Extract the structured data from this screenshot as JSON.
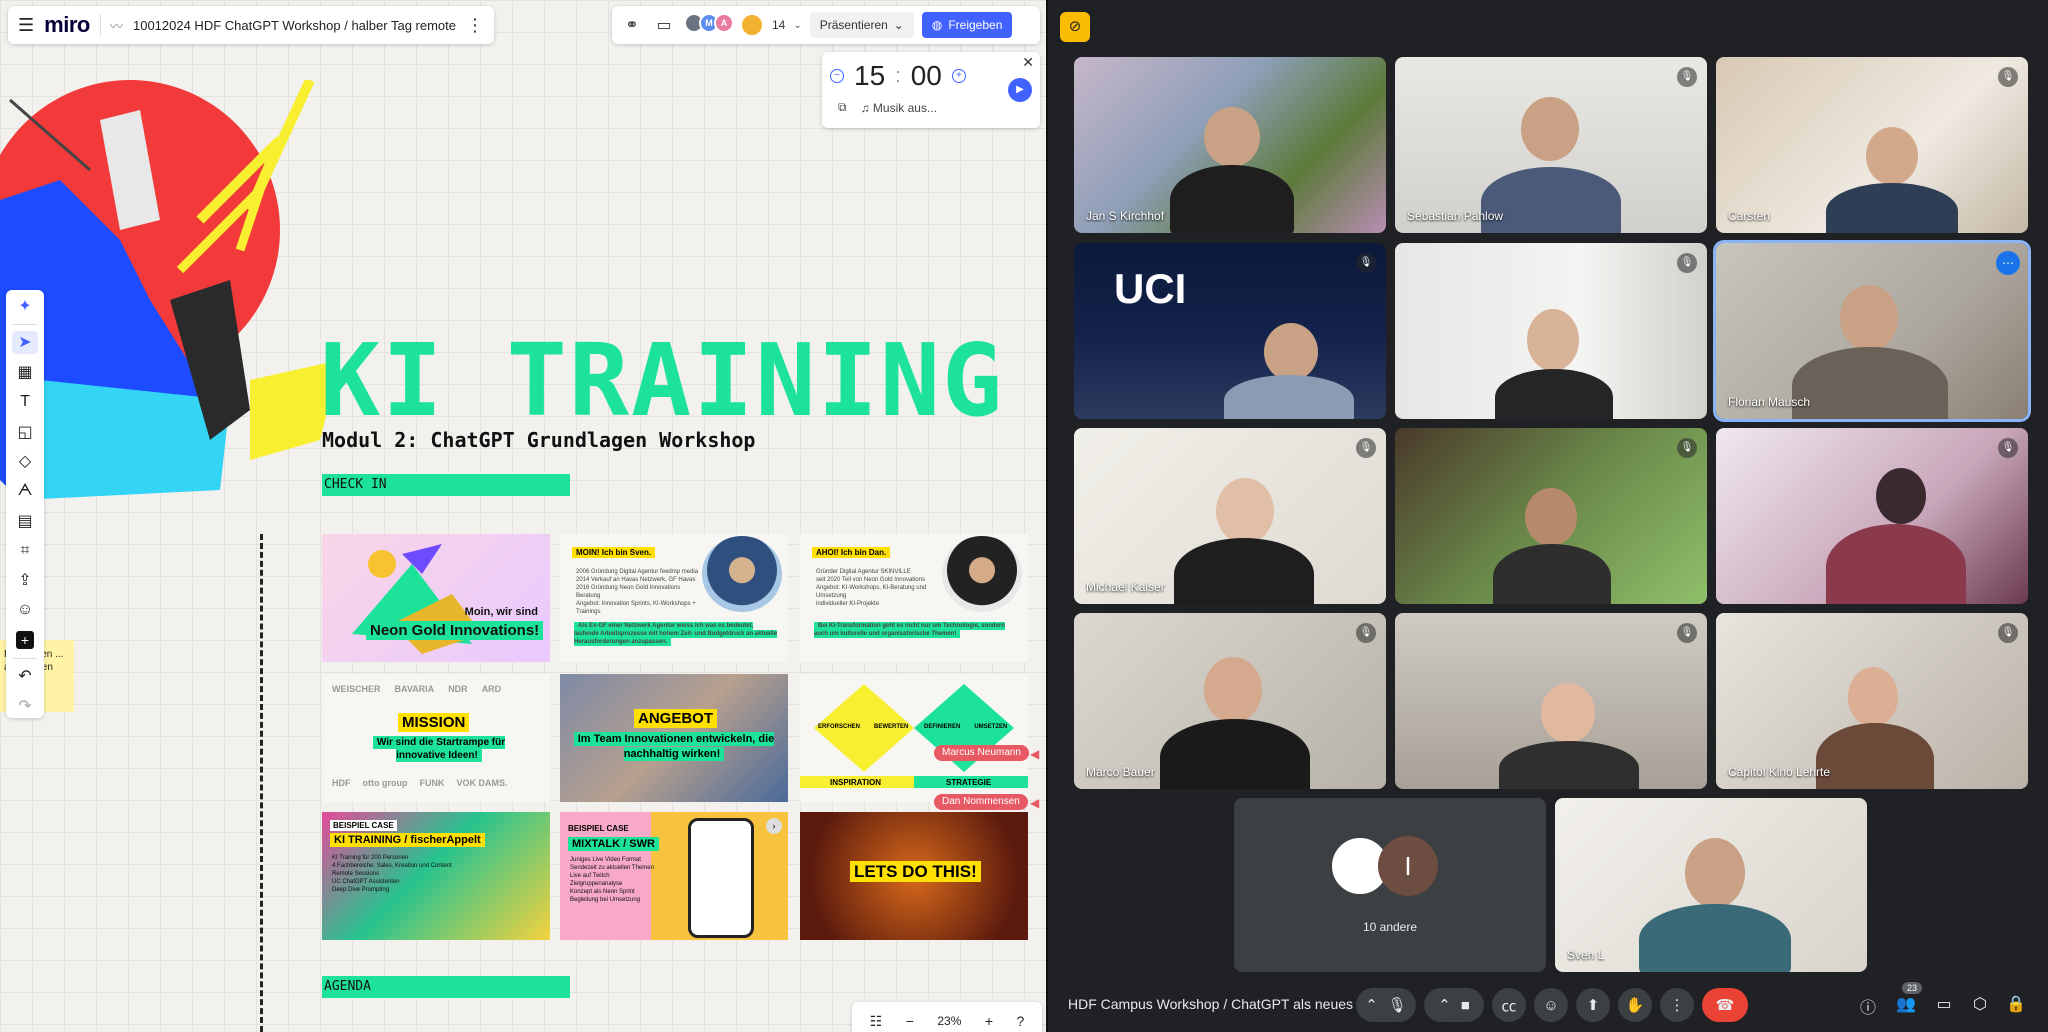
{
  "miro": {
    "logo": "miro",
    "board_name": "10012024 HDF ChatGPT Workshop / halber Tag remote",
    "collaborators_count": "14",
    "avatar_initials": [
      "",
      "M",
      "A"
    ],
    "present_label": "Präsentieren",
    "share_label": "Freigeben",
    "timer": {
      "minutes": "15",
      "seconds": "00",
      "music_label": "Musik aus..."
    },
    "zoom": "23%",
    "sticky_text": "F... Cr... en ... auf ... cken"
  },
  "board": {
    "title": "KI TRAINING",
    "subtitle": "Modul 2: ChatGPT Grundlagen Workshop",
    "checkin_label": "CHECK IN",
    "agenda_label": "AGENDA",
    "cards": [
      {
        "caption_line1": "Moin, wir sind",
        "caption_line2": "Neon Gold Innovations!"
      },
      {
        "header": "MOIN! Ich bin Sven.",
        "bullets": [
          "2006 Gründung Digital Agentur feedmp media",
          "2014 Verkauf an Havas Netzwerk, GF Havas",
          "2016 Gründung Neon Gold Innovations Beratung",
          "Angebot: Innovation Sprints, KI-Workshops + Trainings"
        ],
        "highlight": "Als Ex-GF einer Netzwerk Agentur weiss ich was es bedeutet, laufende Arbeitsprozesse mit hohem Zeit- und Budgetdruck an aktuelle Herausforderungen anzupassen."
      },
      {
        "header": "AHOI! Ich bin Dan.",
        "bullets": [
          "Gründer Digital Agentur SKINVILLE",
          "seit 2020 Teil von Neon Gold Innovations",
          "Angebot: KI-Workshops, KI-Beratung und Umsetzung",
          "individueller KI-Projekte"
        ],
        "highlight": "Bei KI-Transformation geht es nicht nur um Technologie, sondern auch um kulturelle und organisatorische Themen!"
      },
      {
        "logos": [
          "WEISCHER",
          "BAVARIA",
          "NDR",
          "ARD"
        ],
        "title": "MISSION",
        "text": "Wir sind die Startrampe für innovative Ideen!",
        "logos2": [
          "HDF",
          "otto group",
          "FUNK",
          "VOK DAMS."
        ]
      },
      {
        "title": "ANGEBOT",
        "text": "Im Team Innovationen entwickeln, die nachhaltig wirken!"
      },
      {
        "labels": [
          "ERFORSCHEN",
          "BEWERTEN",
          "DEFINIEREN",
          "UMSETZEN"
        ],
        "bottom": [
          "INSPIRATION",
          "STRATEGIE"
        ]
      },
      {
        "tag": "BEISPIEL CASE",
        "title": "KI TRAINING / fischerAppelt",
        "lines": [
          "KI Training für 200 Personen",
          "4 Fachbereiche: Sales, Kreation und Content",
          "Remote Sessions",
          "UC ChatGPT Assistenten",
          "Deep Dive Prompting"
        ]
      },
      {
        "tag": "BEISPIEL CASE",
        "title": "MIXTALK / SWR",
        "lines": [
          "Juniges Live Video Format",
          "Sendezeit zu aktuellen Themen",
          "Live auf Twitch",
          "Zielgruppenanalyse",
          "Konzept als Neon Sprint",
          "Begleitung bei Umsetzung"
        ]
      },
      {
        "title": "LETS DO THIS!"
      }
    ],
    "cursors": [
      "Marcus Neumann",
      "Dan Nommensen"
    ]
  },
  "meet": {
    "tiles": [
      {
        "name": "Jan S Kirchhof"
      },
      {
        "name": "Sebastian Pahlow"
      },
      {
        "name": "Carsten"
      },
      {
        "name": "",
        "bg_text": "UCI"
      },
      {
        "name": ""
      },
      {
        "name": "Florian Mausch"
      },
      {
        "name": "Michael Kaiser"
      },
      {
        "name": ""
      },
      {
        "name": ""
      },
      {
        "name": "Marco Bauer"
      },
      {
        "name": ""
      },
      {
        "name": "Capitol Kino Lehrte"
      }
    ],
    "others_label": "10 andere",
    "self_name": "Sven L",
    "meeting_title": "HDF Campus Workshop / ChatGPT als neues ...",
    "participants_count": "23"
  }
}
